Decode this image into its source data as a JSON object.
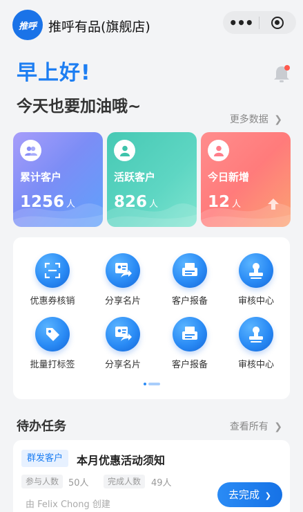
{
  "header": {
    "logo_text": "推呼",
    "store_name": "推呼有品(旗舰店)",
    "capsule_more": "•••",
    "icons": [
      "more-dots-icon",
      "close-target-icon"
    ]
  },
  "greeting": {
    "title": "早上好!",
    "subtitle": "今天也要加油哦~",
    "more_data": "更多数据"
  },
  "stats": [
    {
      "label": "累计客户",
      "value": "1256",
      "unit": "人",
      "color": "#7c8df6"
    },
    {
      "label": "活跃客户",
      "value": "826",
      "unit": "人",
      "color": "#4ccdb9"
    },
    {
      "label": "今日新增",
      "value": "12",
      "unit": "人",
      "color": "#ff8080"
    }
  ],
  "tools": {
    "items": [
      {
        "label": "优惠券核销",
        "icon": "scan-icon"
      },
      {
        "label": "分享名片",
        "icon": "share-card-icon"
      },
      {
        "label": "客户报备",
        "icon": "printer-icon"
      },
      {
        "label": "审核中心",
        "icon": "stamp-icon"
      },
      {
        "label": "批量打标签",
        "icon": "tag-icon"
      },
      {
        "label": "分享名片",
        "icon": "share-card-icon"
      },
      {
        "label": "客户报备",
        "icon": "printer-icon"
      },
      {
        "label": "审核中心",
        "icon": "stamp-icon"
      }
    ]
  },
  "todo": {
    "title": "待办任务",
    "view_all": "查看所有",
    "task": {
      "tag": "群发客户",
      "title": "本月优惠活动须知",
      "participants_label": "参与人数",
      "participants": "50人",
      "completed_label": "完成人数",
      "completed": "49人",
      "creator": "由 Felix Chong 创建",
      "action": "去完成"
    }
  },
  "colors": {
    "accent": "#1d7ef2",
    "background": "#f3f4f6"
  }
}
